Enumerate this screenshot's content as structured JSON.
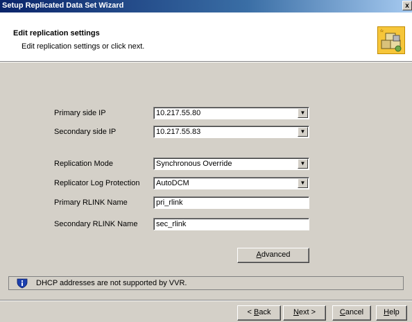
{
  "window": {
    "title": "Setup Replicated Data Set Wizard",
    "close_glyph": "x"
  },
  "header": {
    "title": "Edit replication settings",
    "subtitle": "Edit replication settings or click next.",
    "logo_icon": "wizard-boxes-icon"
  },
  "form": {
    "primary_ip": {
      "label": "Primary side IP",
      "value": "10.217.55.80"
    },
    "secondary_ip": {
      "label": "Secondary side IP",
      "value": "10.217.55.83"
    },
    "replication_mode": {
      "label": "Replication Mode",
      "value": "Synchronous Override"
    },
    "log_protection": {
      "label": "Replicator Log Protection",
      "value": "AutoDCM"
    },
    "primary_rlink": {
      "label": "Primary RLINK Name",
      "value": "pri_rlink"
    },
    "secondary_rlink": {
      "label": "Secondary RLINK Name",
      "value": "sec_rlink"
    }
  },
  "advanced_button": {
    "mnemonic": "A",
    "rest": "dvanced"
  },
  "info": {
    "icon": "info-shield-icon",
    "text": "DHCP addresses are not supported by VVR."
  },
  "buttons": {
    "back": {
      "prefix": "< ",
      "mnemonic": "B",
      "rest": "ack"
    },
    "next": {
      "mnemonic": "N",
      "rest": "ext >"
    },
    "cancel": {
      "mnemonic": "C",
      "rest": "ancel"
    },
    "help": {
      "mnemonic": "H",
      "rest": "elp"
    }
  },
  "colors": {
    "titlebar_start": "#0a246a",
    "titlebar_end": "#a6caf0",
    "dialog_face": "#d4d0c8",
    "logo_fill": "#f6c63a",
    "info_shield": "#1c3fae"
  }
}
